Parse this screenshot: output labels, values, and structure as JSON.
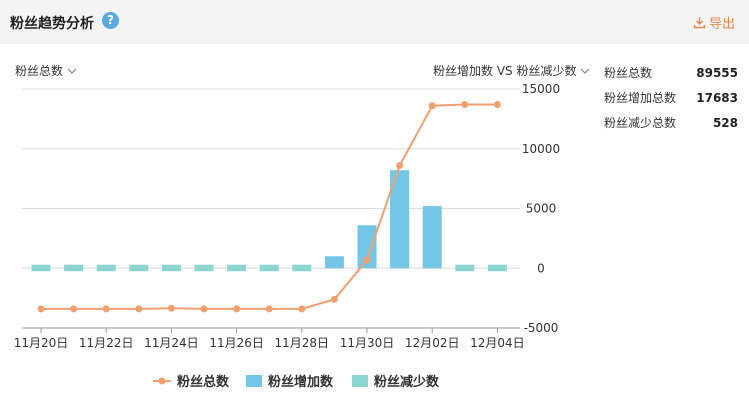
{
  "header": {
    "title": "粉丝趋势分析",
    "help_icon": "question-circle-icon",
    "export_label": "导出",
    "export_icon": "download-icon"
  },
  "controls": {
    "left_dropdown": "粉丝总数",
    "right_dropdown": "粉丝增加数 VS 粉丝减少数"
  },
  "stats": [
    {
      "label": "粉丝总数",
      "value": "89555"
    },
    {
      "label": "粉丝增加总数",
      "value": "17683"
    },
    {
      "label": "粉丝减少总数",
      "value": "528"
    }
  ],
  "colors": {
    "line": "#f0a070",
    "increase": "#73c6e6",
    "decrease": "#8dd5d0",
    "accent": "#e8884b"
  },
  "chart_data": {
    "type": "bar+line",
    "x": [
      "11/20",
      "11/21",
      "11/22",
      "11/23",
      "11/24",
      "11/25",
      "11/26",
      "11/27",
      "11/28",
      "11/29",
      "11/30",
      "12/01",
      "12/02",
      "12/03",
      "12/04"
    ],
    "x_tick_labels": [
      "11月20日",
      "11月22日",
      "11月24日",
      "11月26日",
      "11月28日",
      "11月30日",
      "12月02日",
      "12月04日"
    ],
    "yticks": [
      "15000",
      "10000",
      "5000",
      "0",
      "-5000"
    ],
    "ylim": [
      -5000,
      15000
    ],
    "grid": true,
    "legend_position": "bottom",
    "series": [
      {
        "name": "粉丝总数",
        "type": "line",
        "values": [
          -3400,
          -3400,
          -3400,
          -3400,
          -3350,
          -3400,
          -3400,
          -3400,
          -3400,
          -2600,
          700,
          8600,
          13600,
          13700,
          13700
        ]
      },
      {
        "name": "粉丝增加数",
        "type": "bar",
        "values": [
          0,
          0,
          0,
          0,
          0,
          0,
          0,
          0,
          0,
          1000,
          3600,
          8200,
          5200,
          0,
          0
        ]
      },
      {
        "name": "粉丝减少数",
        "type": "bar",
        "values": [
          300,
          300,
          300,
          300,
          300,
          300,
          300,
          300,
          300,
          0,
          0,
          0,
          0,
          300,
          300
        ]
      }
    ]
  }
}
